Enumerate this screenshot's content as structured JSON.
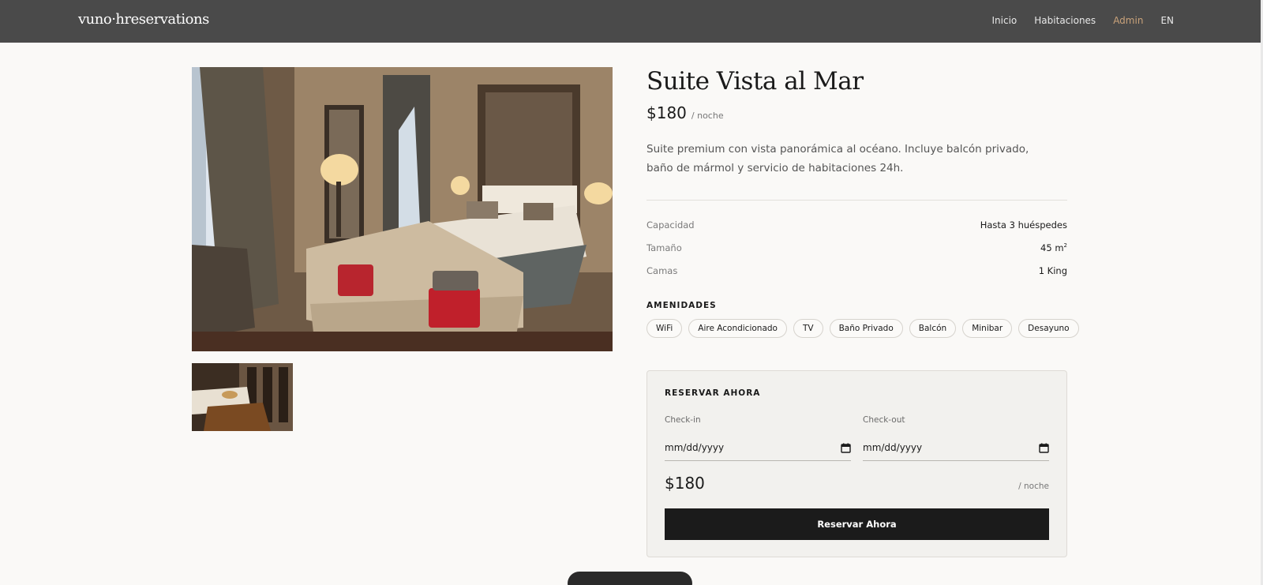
{
  "header": {
    "brand": "vuno·hreservations",
    "nav": [
      "Inicio",
      "Habitaciones",
      "Admin",
      "EN"
    ]
  },
  "room": {
    "title": "Suite Vista al Mar",
    "price": "$180",
    "per_night": "/ noche",
    "description": "Suite premium con vista panorámica al océano. Incluye balcón privado, baño de mármol y servicio de habitaciones 24h.",
    "specs": [
      {
        "label": "Capacidad",
        "value": "Hasta 3 huéspedes"
      },
      {
        "label": "Tamaño",
        "value": "45 m",
        "sup": "2"
      },
      {
        "label": "Camas",
        "value": "1 King"
      }
    ],
    "amenities_title": "AMENIDADES",
    "amenities": [
      "WiFi",
      "Aire Acondicionado",
      "TV",
      "Baño Privado",
      "Balcón",
      "Minibar",
      "Desayuno"
    ]
  },
  "booking": {
    "title": "RESERVAR AHORA",
    "checkin_label": "Check-in",
    "checkout_label": "Check-out",
    "checkin_placeholder": "mm/dd/yyyy",
    "checkout_placeholder": "mm/dd/yyyy",
    "total": "$180",
    "total_per": "/ noche",
    "button": "Reservar Ahora"
  },
  "colors": {
    "header_bg": "#4a4a4a",
    "accent": "#c9a27a",
    "button_bg": "#1b1b1b",
    "page_bg": "#faf9f7"
  }
}
